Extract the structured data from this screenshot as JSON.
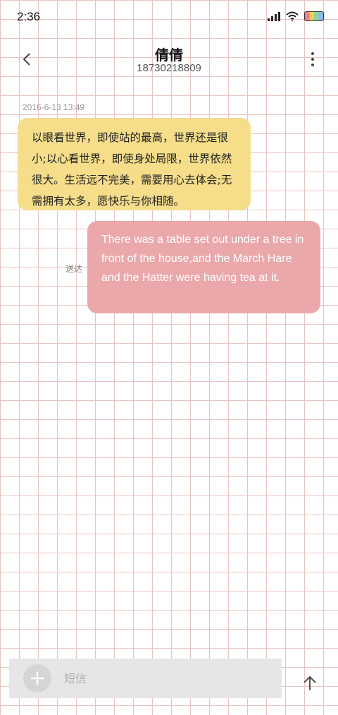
{
  "status_bar": {
    "time": "2:36",
    "icons": [
      "signal-icon",
      "wifi-icon",
      "battery-icon"
    ]
  },
  "header": {
    "contact_name": "倩倩",
    "contact_number": "18730218809",
    "back_icon": "chevron-left-icon",
    "more_icon": "more-vertical-icon"
  },
  "conversation": {
    "timestamp": "2016-6-13 13:49",
    "messages": [
      {
        "direction": "incoming",
        "text": "以眼看世界，即使站的最高，世界还是很小;以心看世界，即使身处局限，世界依然很大。生活远不完美，需要用心去体会;无需拥有太多，愿快乐与你相随。",
        "bubble_color": "#f5dd8a"
      },
      {
        "direction": "outgoing",
        "text": "There was a table set out under a tree in front of the house,and the March Hare and the Hatter were having tea at it.",
        "status": "送达",
        "bubble_color": "#eaa8ab"
      }
    ]
  },
  "composer": {
    "placeholder": "短信",
    "value": "",
    "add_icon": "plus-icon",
    "send_icon": "arrow-up-icon"
  },
  "colors": {
    "grid_line": "#e7c4c1",
    "input_bar": "#e6e6e6"
  }
}
